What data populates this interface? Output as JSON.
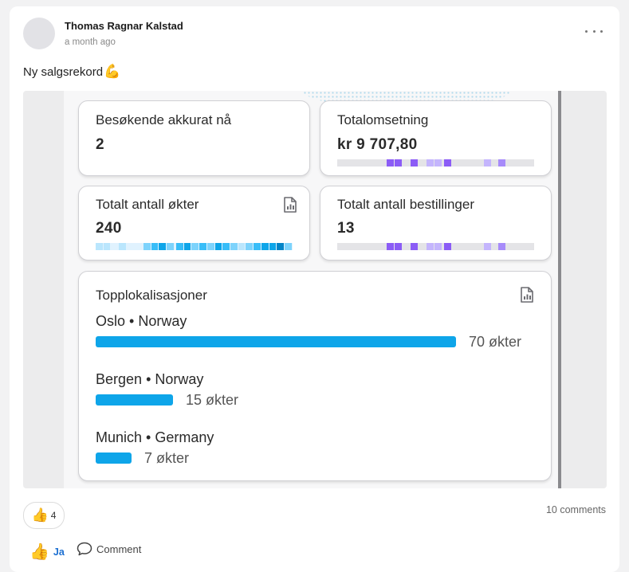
{
  "post": {
    "author": "Thomas Ragnar Kalstad",
    "time": "a month ago",
    "text": "Ny salgsrekord",
    "emoji": "💪"
  },
  "dashboard": {
    "visitors": {
      "title": "Besøkende akkurat nå",
      "value": "2"
    },
    "revenue": {
      "title": "Totalomsetning",
      "value": "kr 9 707,80"
    },
    "sessions": {
      "title": "Totalt antall økter",
      "value": "240"
    },
    "orders": {
      "title": "Totalt antall bestillinger",
      "value": "13"
    },
    "locations": {
      "title": "Topplokalisasjoner",
      "items": [
        {
          "city": "Oslo",
          "country": "Norway",
          "count": "70 økter",
          "sessions": 70
        },
        {
          "city": "Bergen",
          "country": "Norway",
          "count": "15 økter",
          "sessions": 15
        },
        {
          "city": "Munich",
          "country": "Germany",
          "count": "7 økter",
          "sessions": 7
        }
      ]
    },
    "separator": "•",
    "colors": {
      "bar": "#0ea5e9",
      "purple": "#8b5cf6",
      "purple_light": "#c4b5fd",
      "teal": "#0ea5e9",
      "teal_light": "#bae6fd"
    }
  },
  "footer": {
    "reaction_count": "4",
    "comments": "10 comments",
    "like_label": "Ja",
    "comment_label": "Comment"
  },
  "icons": [
    "more-horizontal-icon",
    "report-icon",
    "thumbs-up-icon",
    "comment-bubble-icon",
    "flexed-biceps-emoji"
  ]
}
